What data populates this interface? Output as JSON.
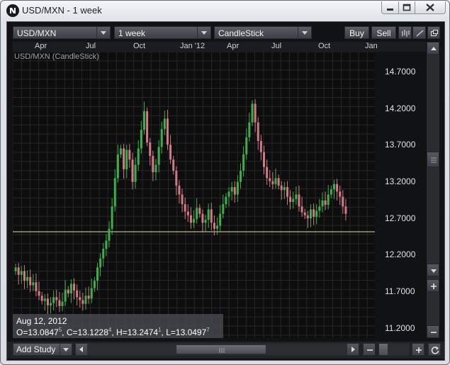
{
  "window": {
    "title": "USD/MXN - 1 week"
  },
  "toolbar": {
    "symbol": "USD/MXN",
    "interval": "1 week",
    "chart_type": "CandleStick",
    "buy_label": "Buy",
    "sell_label": "Sell"
  },
  "chart": {
    "label": "USD/MXN (CandleStick)",
    "x_ticks": [
      "Apr",
      "Jul",
      "Oct",
      "Jan '12",
      "Apr",
      "Jul",
      "Oct",
      "Jan"
    ],
    "y_labels": [
      "14.7000",
      "14.2000",
      "13.7000",
      "13.2000",
      "12.7000",
      "12.2000",
      "11.7000",
      "11.2000"
    ]
  },
  "ohlc": {
    "date": "Aug 12, 2012",
    "open_label": "O=13.0847",
    "open_sup": "5",
    "close_label": "C=13.1228",
    "close_sup": "4",
    "high_label": "H=13.2474",
    "high_sup": "1",
    "low_label": "L=13.0497",
    "low_sup": "7"
  },
  "bottom": {
    "add_study_label": "Add Study"
  },
  "chart_data": {
    "type": "candlestick",
    "label": "USD/MXN (CandleStick)",
    "ylim": [
      11.15,
      15.0
    ],
    "horizontal_line": 12.58,
    "up_color": "#3fae49",
    "down_color": "#d07a84",
    "x_ticks": [
      "Apr",
      "Jul",
      "Oct",
      "Jan '12",
      "Apr",
      "Jul",
      "Oct",
      "Jan"
    ],
    "close": [
      12.1,
      12.0,
      12.05,
      11.92,
      11.97,
      11.86,
      11.9,
      11.78,
      11.72,
      11.65,
      11.68,
      11.59,
      11.62,
      11.7,
      11.66,
      11.58,
      11.64,
      11.8,
      11.75,
      11.88,
      11.79,
      11.7,
      11.66,
      11.61,
      11.72,
      11.68,
      11.82,
      11.92,
      12.1,
      12.22,
      12.35,
      12.46,
      12.62,
      12.92,
      13.3,
      13.62,
      13.7,
      13.42,
      13.68,
      13.55,
      13.25,
      13.48,
      13.7,
      13.95,
      14.2,
      13.78,
      13.6,
      13.38,
      13.48,
      13.72,
      13.96,
      14.1,
      13.75,
      13.55,
      13.4,
      13.2,
      13.08,
      12.95,
      12.85,
      12.8,
      12.7,
      12.75,
      12.9,
      12.82,
      12.7,
      12.74,
      12.88,
      12.7,
      12.62,
      12.66,
      12.82,
      12.95,
      13.05,
      13.12,
      13.18,
      13.08,
      13.25,
      13.4,
      13.62,
      13.85,
      14.05,
      14.3,
      14.05,
      13.8,
      13.65,
      13.45,
      13.3,
      13.26,
      13.22,
      13.3,
      13.2,
      13.14,
      13.18,
      13.05,
      12.98,
      13.02,
      13.08,
      12.92,
      12.84,
      12.8,
      12.76,
      12.88,
      12.78,
      12.86,
      12.92,
      13.0,
      12.94,
      13.08,
      13.15,
      13.22,
      13.12,
      13.05,
      12.92,
      12.82
    ],
    "open": [
      12.05,
      12.1,
      12.0,
      12.05,
      11.92,
      11.97,
      11.86,
      11.9,
      11.78,
      11.72,
      11.65,
      11.68,
      11.59,
      11.62,
      11.7,
      11.66,
      11.58,
      11.64,
      11.8,
      11.75,
      11.88,
      11.79,
      11.7,
      11.66,
      11.61,
      11.72,
      11.68,
      11.82,
      11.92,
      12.1,
      12.22,
      12.35,
      12.46,
      12.62,
      12.92,
      13.3,
      13.62,
      13.7,
      13.42,
      13.68,
      13.55,
      13.25,
      13.48,
      13.7,
      13.95,
      14.2,
      13.78,
      13.6,
      13.38,
      13.48,
      13.72,
      13.96,
      14.1,
      13.75,
      13.55,
      13.4,
      13.2,
      13.08,
      12.95,
      12.85,
      12.8,
      12.7,
      12.75,
      12.9,
      12.82,
      12.7,
      12.74,
      12.88,
      12.7,
      12.62,
      12.66,
      12.82,
      12.95,
      13.05,
      13.12,
      13.18,
      13.08,
      13.25,
      13.4,
      13.62,
      13.85,
      14.05,
      14.3,
      14.05,
      13.8,
      13.65,
      13.45,
      13.3,
      13.26,
      13.22,
      13.3,
      13.2,
      13.14,
      13.18,
      13.05,
      12.98,
      13.02,
      13.08,
      12.92,
      12.84,
      12.8,
      12.76,
      12.88,
      12.78,
      12.86,
      12.92,
      13.0,
      12.94,
      13.08,
      13.15,
      13.22,
      13.12,
      13.05,
      12.92
    ]
  }
}
